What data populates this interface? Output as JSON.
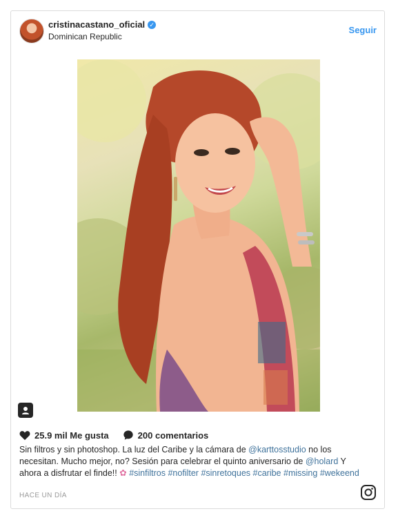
{
  "post": {
    "username": "cristinacastano_oficial",
    "location": "Dominican Republic",
    "follow_label": "Seguir",
    "likes_text": "25.9 mil Me gusta",
    "comments_text": "200 comentarios",
    "caption": {
      "text1": "Sin filtros y sin photoshop. La luz del Caribe y la cámara de ",
      "mention1": "@karttosstudio",
      "text2": " no los necesitan. Mucho mejor, no? Sesión para celebrar el quinto aniversario de ",
      "mention2": "@holard",
      "text3": " Y ahora a disfrutar el finde!! ",
      "hashtags": [
        "#sinfiltros",
        "#nofilter",
        "#sinretoques",
        "#caribe",
        "#missing",
        "#wekeend"
      ]
    },
    "timestamp": "HACE UN DÍA"
  },
  "icons": [
    "verified-badge-icon",
    "tag-people-icon",
    "heart-icon",
    "comment-icon",
    "flower-emoji-icon",
    "instagram-logo-icon"
  ],
  "colors": {
    "link": "#3f729b",
    "follow": "#3897f0",
    "text": "#262626",
    "muted": "#999999",
    "border": "#dbdbdb"
  }
}
